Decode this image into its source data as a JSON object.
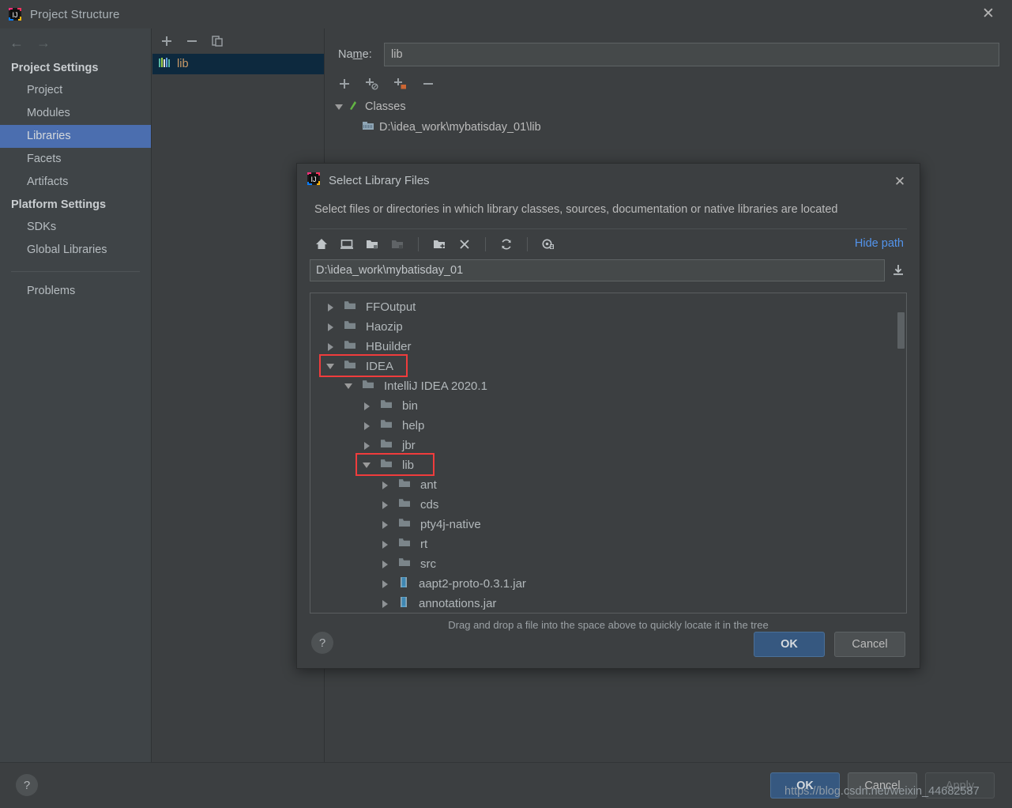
{
  "window": {
    "title": "Project Structure",
    "logo_icon": "intellij-idea-logo-icon",
    "close_icon": "close-icon",
    "back_icon": "back-arrow-icon",
    "forward_icon": "forward-arrow-icon"
  },
  "sidebar": {
    "groups": [
      {
        "title": "Project Settings",
        "items": [
          "Project",
          "Modules",
          "Libraries",
          "Facets",
          "Artifacts"
        ]
      },
      {
        "title": "Platform Settings",
        "items": [
          "SDKs",
          "Global Libraries"
        ]
      }
    ],
    "selected": "Libraries",
    "problems_label": "Problems"
  },
  "libraries_panel": {
    "toolbar": [
      {
        "name": "add-library-button",
        "glyph": "+"
      },
      {
        "name": "remove-library-button",
        "glyph": "−"
      },
      {
        "name": "copy-library-button",
        "glyph": "copy-icon"
      }
    ],
    "items": [
      {
        "label": "lib",
        "icon": "library-icon",
        "selected": true
      }
    ]
  },
  "detail": {
    "name_label_before": "Na",
    "name_label_mnemonic": "m",
    "name_label_after": "e:",
    "name_value": "lib",
    "name_placeholder": "",
    "roots_toolbar": [
      {
        "name": "add-root-button",
        "glyph": "+"
      },
      {
        "name": "add-sources-root-button",
        "glyph": "+src"
      },
      {
        "name": "add-jar-directory-button",
        "glyph": "+jar"
      },
      {
        "name": "remove-root-button",
        "glyph": "−"
      }
    ],
    "tree": [
      {
        "label": "Classes",
        "icon": "classes-root-icon",
        "expanded": true,
        "depth": 0
      },
      {
        "label": "D:\\idea_work\\mybatisday_01\\lib",
        "icon": "jar-directory-icon",
        "depth": 1
      }
    ]
  },
  "footer": {
    "help_label": "?",
    "ok_label": "OK",
    "cancel_label": "Cancel",
    "apply_label": "Apply"
  },
  "watermark": "https://blog.csdn.net/weixin_44682587",
  "dialog": {
    "logo_icon": "intellij-idea-logo-icon",
    "title": "Select Library Files",
    "close_icon": "close-icon",
    "description": "Select files or directories in which library classes, sources, documentation or native libraries are located",
    "toolbar": [
      {
        "name": "home-directory-icon",
        "glyph": "home"
      },
      {
        "name": "desktop-directory-icon",
        "glyph": "desktop"
      },
      {
        "name": "project-directory-icon",
        "glyph": "project-folder"
      },
      {
        "name": "module-directory-icon",
        "glyph": "module-folder",
        "disabled": true
      },
      {
        "name": "new-folder-icon",
        "glyph": "folder-plus"
      },
      {
        "name": "delete-icon",
        "glyph": "x"
      },
      {
        "name": "refresh-icon",
        "glyph": "refresh"
      },
      {
        "name": "show-hidden-files-icon",
        "glyph": "hidden-files"
      }
    ],
    "hide_path_label": "Hide path",
    "path_value": "D:\\idea_work\\mybatisday_01",
    "path_placeholder": "",
    "download_icon": "download-icon",
    "tree": [
      {
        "label": "FFOutput",
        "type": "folder",
        "depth": 0,
        "state": "collapsed"
      },
      {
        "label": "Haozip",
        "type": "folder",
        "depth": 0,
        "state": "collapsed"
      },
      {
        "label": "HBuilder",
        "type": "folder",
        "depth": 0,
        "state": "collapsed"
      },
      {
        "label": "IDEA",
        "type": "folder",
        "depth": 0,
        "state": "expanded",
        "highlighted": true
      },
      {
        "label": "IntelliJ IDEA 2020.1",
        "type": "folder",
        "depth": 1,
        "state": "expanded"
      },
      {
        "label": "bin",
        "type": "folder",
        "depth": 2,
        "state": "collapsed"
      },
      {
        "label": "help",
        "type": "folder",
        "depth": 2,
        "state": "collapsed"
      },
      {
        "label": "jbr",
        "type": "folder",
        "depth": 2,
        "state": "collapsed"
      },
      {
        "label": "lib",
        "type": "folder",
        "depth": 2,
        "state": "expanded",
        "highlighted": true
      },
      {
        "label": "ant",
        "type": "folder",
        "depth": 3,
        "state": "collapsed"
      },
      {
        "label": "cds",
        "type": "folder",
        "depth": 3,
        "state": "collapsed"
      },
      {
        "label": "pty4j-native",
        "type": "folder",
        "depth": 3,
        "state": "collapsed"
      },
      {
        "label": "rt",
        "type": "folder",
        "depth": 3,
        "state": "collapsed"
      },
      {
        "label": "src",
        "type": "folder",
        "depth": 3,
        "state": "collapsed"
      },
      {
        "label": "aapt2-proto-0.3.1.jar",
        "type": "jar",
        "depth": 3,
        "state": "collapsed"
      },
      {
        "label": "annotations.jar",
        "type": "jar",
        "depth": 3,
        "state": "collapsed"
      }
    ],
    "drag_hint": "Drag and drop a file into the space above to quickly locate it in the tree",
    "help_label": "?",
    "ok_label": "OK",
    "cancel_label": "Cancel"
  }
}
